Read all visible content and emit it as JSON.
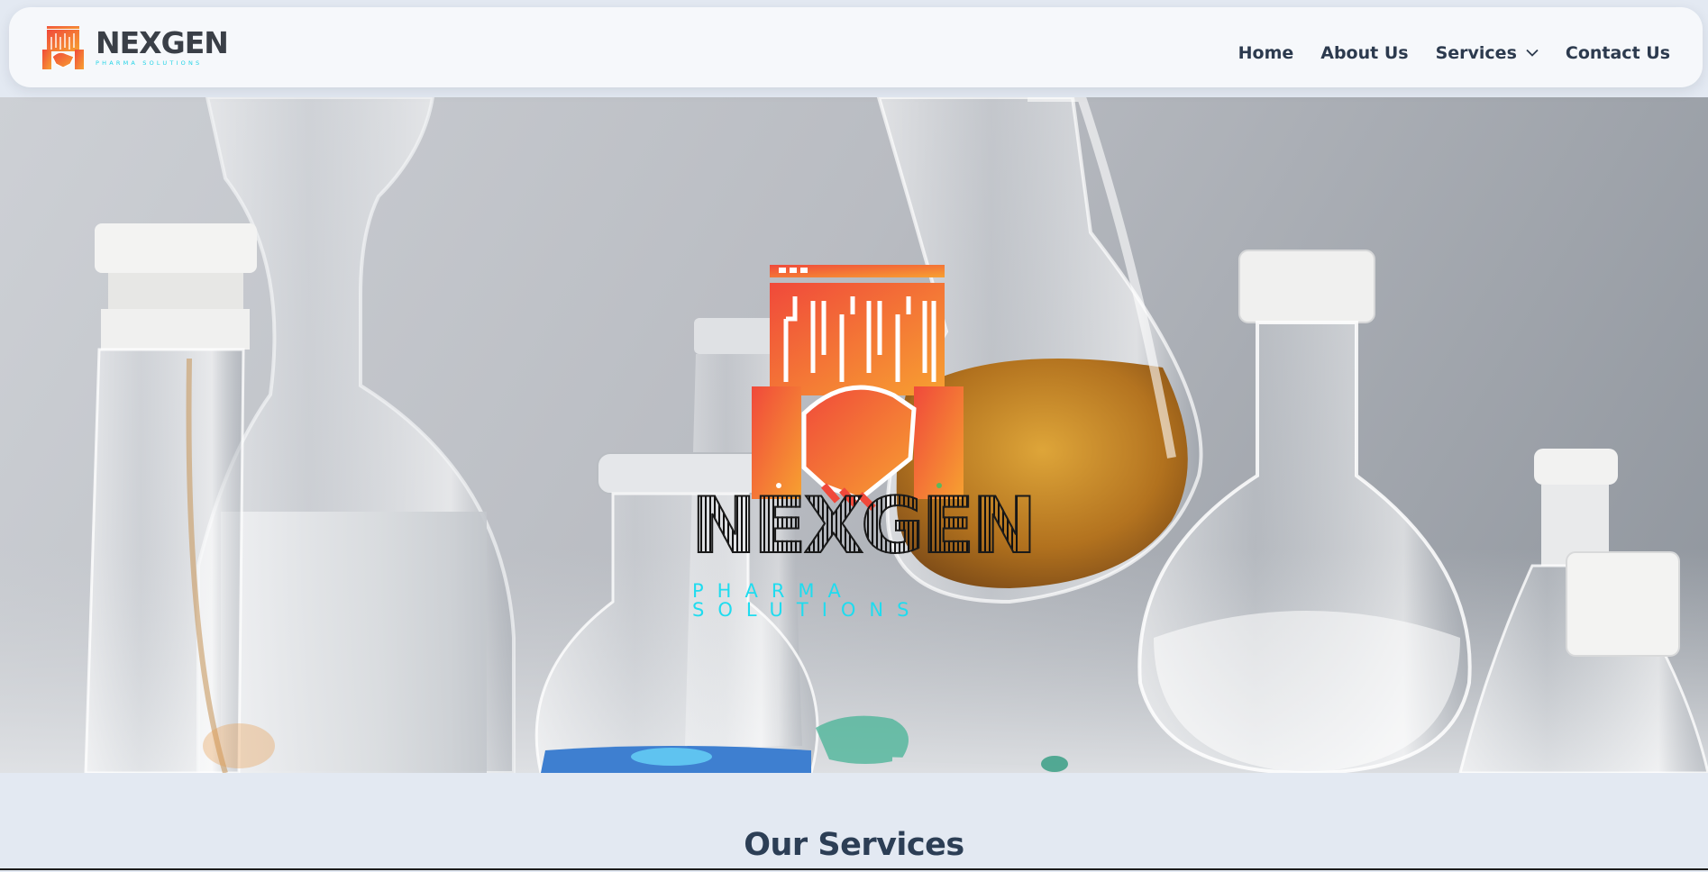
{
  "brand": {
    "name": "NEXGEN",
    "tagline": "PHARMA SOLUTIONS",
    "logo_icon": "lab-handshake-logo-icon",
    "colors": {
      "gradient_start": "#f0493b",
      "gradient_end": "#f7a131",
      "tagline": "#22d3e6",
      "name": "#3a3f47"
    }
  },
  "nav": {
    "items": [
      {
        "label": "Home"
      },
      {
        "label": "About Us"
      },
      {
        "label": "Services",
        "icon": "chevron-down-icon"
      },
      {
        "label": "Contact Us"
      }
    ]
  },
  "hero": {
    "name": "NEXGEN",
    "tagline": "PHARMA SOLUTIONS",
    "background": "laboratory-glassware-photo"
  },
  "services": {
    "title": "Our Services"
  }
}
